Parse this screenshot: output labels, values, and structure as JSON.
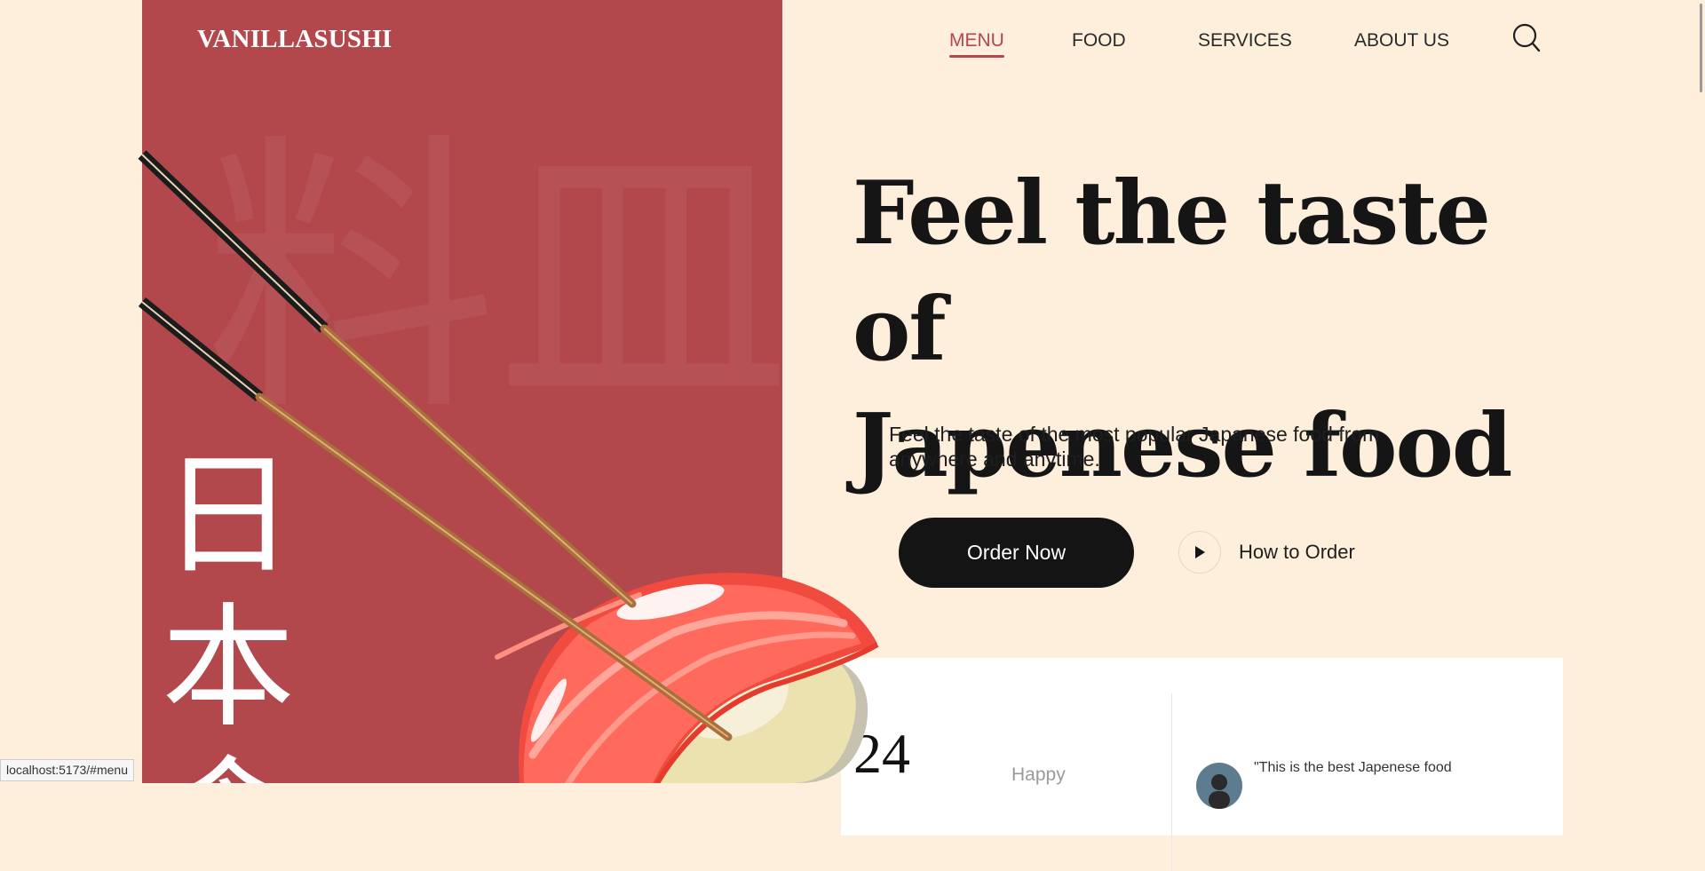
{
  "brand": {
    "logo": "VANILLASUSHI"
  },
  "nav": {
    "items": [
      {
        "label": "MENU",
        "active": true
      },
      {
        "label": "FOOD",
        "active": false
      },
      {
        "label": "SERVICES",
        "active": false
      },
      {
        "label": "ABOUT US",
        "active": false
      }
    ],
    "search_icon": "search-icon"
  },
  "decor": {
    "watermark_left": "料",
    "watermark_right": "皿",
    "vertical_kanji": [
      "日",
      "本",
      "食"
    ]
  },
  "hero": {
    "title_line1": "Feel the taste of",
    "title_line2": "Japenese food",
    "subtitle_line1": "Feel the taste of the most popular Japanese food from",
    "subtitle_line2": "anywhere and anytime.",
    "order_button": "Order Now",
    "how_to_order": "How to Order",
    "play_icon": "play-icon"
  },
  "stats": {
    "number": "24",
    "label": "Happy",
    "review_quote": "\"This is the best Japenese food"
  },
  "status_bar": {
    "url": "localhost:5173/#menu"
  },
  "colors": {
    "background": "#FEEEDC",
    "panel": "#B2474C",
    "accent": "#B2474C",
    "button": "#141414",
    "text": "#151515"
  }
}
